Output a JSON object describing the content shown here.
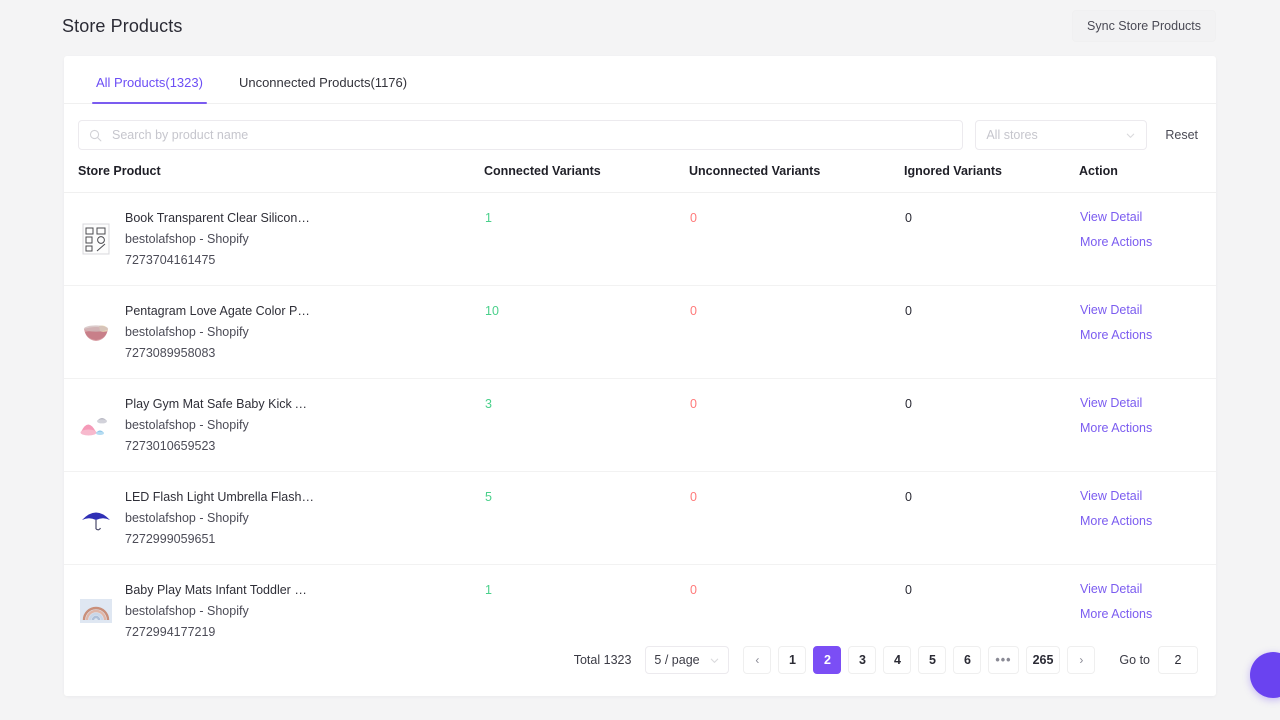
{
  "header": {
    "title": "Store Products",
    "sync_button": "Sync Store Products"
  },
  "tabs": [
    {
      "label": "All Products(1323)",
      "active": true
    },
    {
      "label": "Unconnected Products(1176)",
      "active": false
    }
  ],
  "filters": {
    "search_placeholder": "Search by product name",
    "search_value": "",
    "store_select_value": "All stores",
    "reset_label": "Reset"
  },
  "table": {
    "columns": [
      "Store Product",
      "Connected Variants",
      "Unconnected Variants",
      "Ignored Variants",
      "Action"
    ],
    "rows": [
      {
        "name": "Book Transparent Clear Silicone St...",
        "store": "bestolafshop - Shopify",
        "id": "7273704161475",
        "connected": "1",
        "unconnected": "0",
        "ignored": "0",
        "view_detail": "View Detail",
        "more_actions": "More Actions",
        "thumb": "stencil-sheet"
      },
      {
        "name": "Pentagram Love Agate Color Patte...",
        "store": "bestolafshop - Shopify",
        "id": "7273089958083",
        "connected": "10",
        "unconnected": "0",
        "ignored": "0",
        "view_detail": "View Detail",
        "more_actions": "More Actions",
        "thumb": "agate-bowl"
      },
      {
        "name": "Play Gym Mat Safe Baby Kick And ...",
        "store": "bestolafshop - Shopify",
        "id": "7273010659523",
        "connected": "3",
        "unconnected": "0",
        "ignored": "0",
        "view_detail": "View Detail",
        "more_actions": "More Actions",
        "thumb": "play-gym"
      },
      {
        "name": "LED Flash Light Umbrella Flashligh...",
        "store": "bestolafshop - Shopify",
        "id": "7272999059651",
        "connected": "5",
        "unconnected": "0",
        "ignored": "0",
        "view_detail": "View Detail",
        "more_actions": "More Actions",
        "thumb": "umbrella"
      },
      {
        "name": "Baby Play Mats Infant Toddler Cra...",
        "store": "bestolafshop - Shopify",
        "id": "7272994177219",
        "connected": "1",
        "unconnected": "0",
        "ignored": "0",
        "view_detail": "View Detail",
        "more_actions": "More Actions",
        "thumb": "rainbow-mat"
      }
    ]
  },
  "pagination": {
    "total_text": "Total 1323",
    "page_size": "5 / page",
    "prev": "‹",
    "next": "›",
    "pages": [
      "1",
      "2",
      "3",
      "4",
      "5",
      "6",
      "•••",
      "265"
    ],
    "current_page": "2",
    "goto_label": "Go to",
    "goto_value": "2"
  },
  "colors": {
    "accent": "#7b5cf0",
    "active_page": "#7b4ef5",
    "connected": "#4ad08b",
    "unconnected": "#ff7a7a",
    "background": "#f4f4f5",
    "card": "#ffffff"
  }
}
